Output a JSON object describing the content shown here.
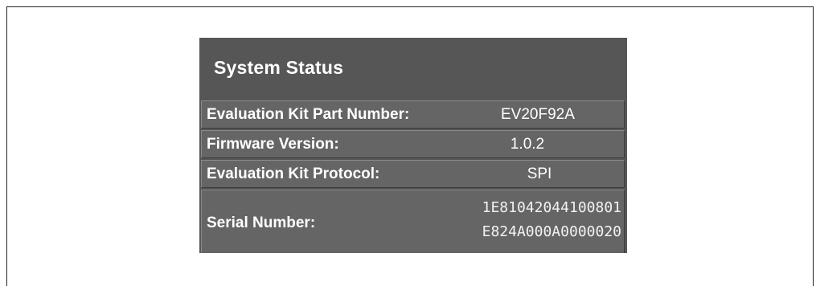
{
  "system_status": {
    "title": "System Status",
    "rows": [
      {
        "label": "Evaluation Kit Part Number:",
        "value": "EV20F92A"
      },
      {
        "label": "Firmware Version:",
        "value": "1.0.2"
      },
      {
        "label": "Evaluation Kit Protocol:",
        "value": "SPI"
      },
      {
        "label": "Serial Number:",
        "value_lines": [
          "1E81042044100801",
          "E824A000A0000020"
        ]
      }
    ]
  },
  "colors": {
    "panel_background": "#565656",
    "row_background": "#656565",
    "text": "#ffffff"
  }
}
